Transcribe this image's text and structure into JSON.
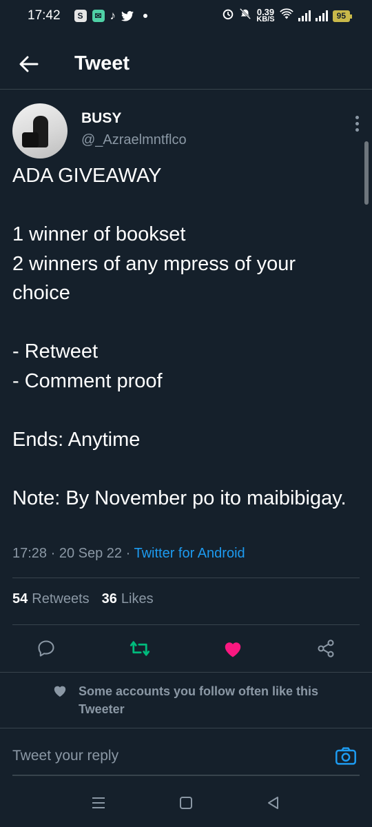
{
  "status_bar": {
    "time": "17:42",
    "speed_value": "0.39",
    "speed_unit": "KB/S",
    "battery": "95",
    "left_icons": [
      "shopee-icon",
      "messenger-icon",
      "tiktok-icon",
      "twitter-icon"
    ]
  },
  "header": {
    "title": "Tweet"
  },
  "tweet": {
    "display_name": "BUSY",
    "handle": "@_Azraelmntflco",
    "text": "ADA GIVEAWAY\n\n1 winner of bookset\n2 winners of any mpress of your choice\n\n- Retweet\n- Comment proof\n\nEnds: Anytime\n\nNote: By November po ito maibibigay.",
    "time": "17:28",
    "date": "20 Sep 22",
    "source": "Twitter for Android",
    "retweets_count": "54",
    "retweets_label": "Retweets",
    "likes_count": "36",
    "likes_label": "Likes"
  },
  "colors": {
    "background": "#15202b",
    "retweet_active": "#00ba7c",
    "like_active": "#f91880",
    "link": "#1d9bf0"
  },
  "social_context": {
    "text": "Some accounts you follow often like this Tweeter"
  },
  "reply": {
    "placeholder": "Tweet your reply"
  }
}
